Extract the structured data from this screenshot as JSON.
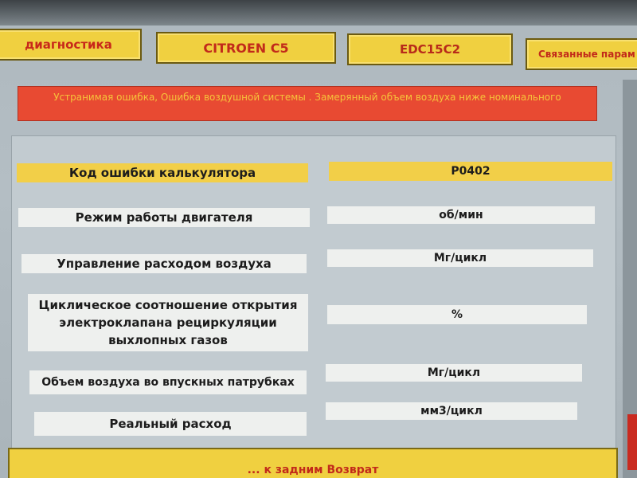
{
  "tabs": [
    {
      "label": "диагностика"
    },
    {
      "label": "CITROEN C5"
    },
    {
      "label": "EDC15C2"
    },
    {
      "label": "Связанные парам"
    }
  ],
  "error": {
    "message": "Устранимая ошибка, Ошибка воздушной системы . Замерянный объем воздуха ниже номинального"
  },
  "table": {
    "header": {
      "label": "Код ошибки калькулятора",
      "value": "P0402"
    },
    "rows": [
      {
        "label": "Режим работы двигателя",
        "value": "об/мин"
      },
      {
        "label": "Управление расходом воздуха",
        "value": "Мг/цикл"
      },
      {
        "label": "Циклическое соотношение открытия электроклапана рециркуляции выхлопных газов",
        "value": "%"
      },
      {
        "label": "Объем воздуха во впускных патрубках",
        "value": "Мг/цикл"
      },
      {
        "label": "Реальный расход",
        "value": "мм3/цикл"
      }
    ]
  },
  "footer": {
    "label": "... к задним Возврат"
  }
}
